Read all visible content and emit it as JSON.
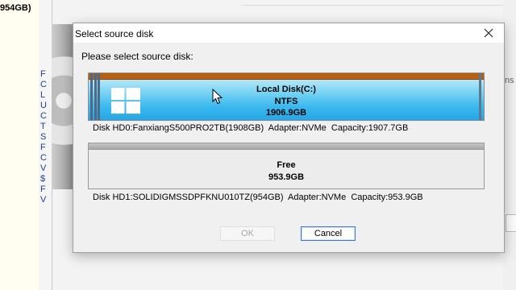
{
  "background": {
    "left_text": "954GB)",
    "left_letters": [
      "F",
      "C",
      "L",
      "U",
      "C",
      "T",
      "S",
      "F",
      "C",
      "V",
      "$",
      "F",
      "V"
    ],
    "right_text": "ns"
  },
  "dialog": {
    "title": "Select source disk",
    "close_icon": "close-icon",
    "prompt": "Please select source disk:",
    "disks": [
      {
        "partition": {
          "name": "Local Disk(C:)",
          "filesystem": "NTFS",
          "size": "1906.9GB",
          "icon": "windows-logo-icon",
          "color": "#3ab8ee"
        },
        "info": "Disk HD0:FanxiangS500PRO2TB(1908GB)  Adapter:NVMe  Capacity:1907.7GB"
      },
      {
        "partition": {
          "name": "Free",
          "size": "953.9GB",
          "color": "#ececec"
        },
        "info": "Disk HD1:SOLIDIGMSSDPFKNU010TZ(954GB)  Adapter:NVMe  Capacity:953.9GB"
      }
    ],
    "buttons": {
      "ok": "OK",
      "cancel": "Cancel"
    }
  }
}
